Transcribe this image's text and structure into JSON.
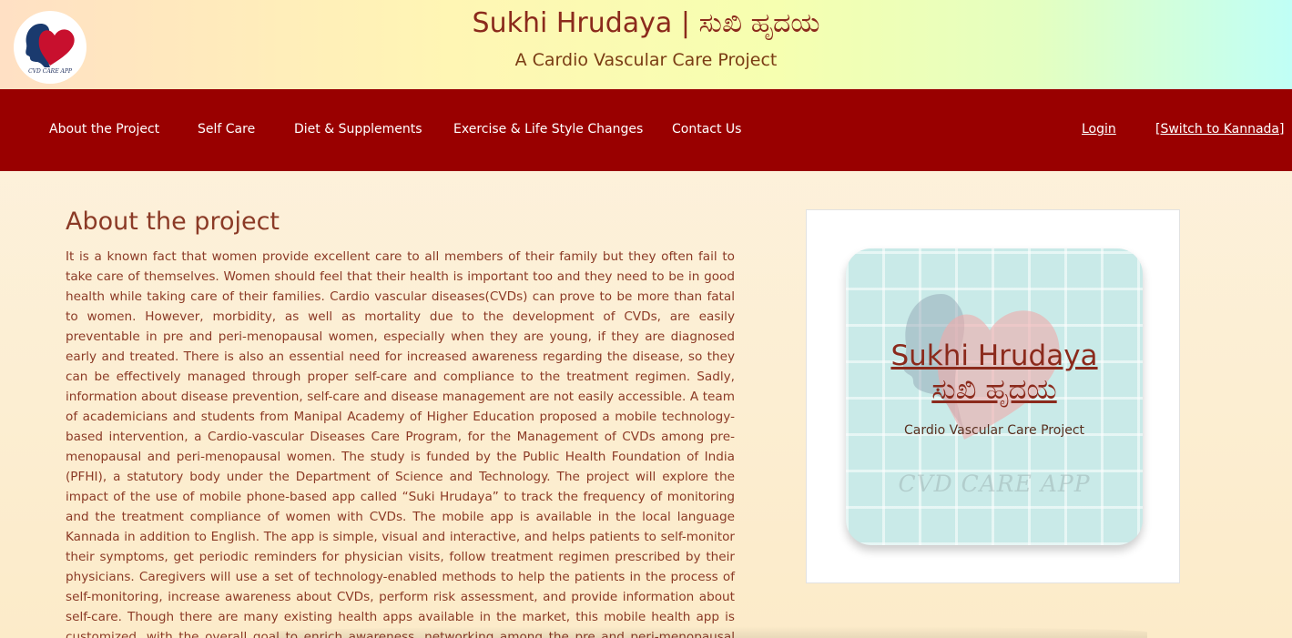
{
  "header": {
    "title": "Sukhi Hrudaya | ಸುಖಿ ಹೃದಯ",
    "subtitle": "A Cardio Vascular Care Project",
    "logo_text": "CVD CARE APP"
  },
  "nav": {
    "items": [
      {
        "label": "About the Project"
      },
      {
        "label": "Self Care"
      },
      {
        "label": "Diet & Supplements"
      },
      {
        "label": "Exercise & Life Style Changes"
      },
      {
        "label": "Contact Us"
      }
    ],
    "login": "Login",
    "switch_language": "[Switch to Kannada]"
  },
  "main": {
    "heading": "About the project",
    "body": "It is a known fact that women provide excellent care to all members of their family but they often fail to take care of themselves. Women should feel that their health is important too and they need to be in good health while taking care of their families. Cardio vascular diseases(CVDs) can prove to be more than fatal to women. However, morbidity, as well as mortality due to the development of CVDs, are easily preventable in pre and peri-menopausal women, especially when they are young, if they are diagnosed early and treated. There is also an essential need for increased awareness regarding the disease, so they can be effectively managed through proper self-care and compliance to the treatment regimen. Sadly, information about disease prevention, self-care and disease management are not easily accessible. A team of academicians and students from Manipal Academy of Higher Education proposed a mobile technology-based intervention, a Cardio-vascular Diseases Care Program, for the Management of CVDs among pre-menopausal and peri-menopausal women. The study is funded by the Public Health Foundation of India (PFHI), a statutory body under the Department of Science and Technology. The project will explore the impact of the use of mobile phone-based app called “Suki Hrudaya” to track the frequency of monitoring and the treatment compliance of women with CVDs. The mobile app is available in the local language Kannada in addition to English. The app is simple, visual and interactive, and helps patients to self-monitor their symptoms, get periodic reminders for physician visits, follow treatment regimen prescribed by their physicians. Caregivers will use a set of technology-enabled methods to help the patients in the process of self-monitoring, increase awareness about CVDs, perform risk assessment, and provide information about self-care. Though there are many existing health apps available in the market, this mobile health app is customized, with the overall goal to enrich awareness, networking among the pre and peri-menopausal women with CVDs, living in the towns and villages of Udupi distict. In"
  },
  "app_card": {
    "title_en": "Sukhi Hrudaya",
    "title_kn": "ಸುಖಿ ಹೃದಯ",
    "subtitle": "Cardio Vascular Care Project",
    "watermark": "CVD CARE APP"
  },
  "colors": {
    "nav_background": "#990000",
    "heading_text": "#8b3a26",
    "heart_red": "#c8102e",
    "tile_background": "#c9eae8"
  }
}
